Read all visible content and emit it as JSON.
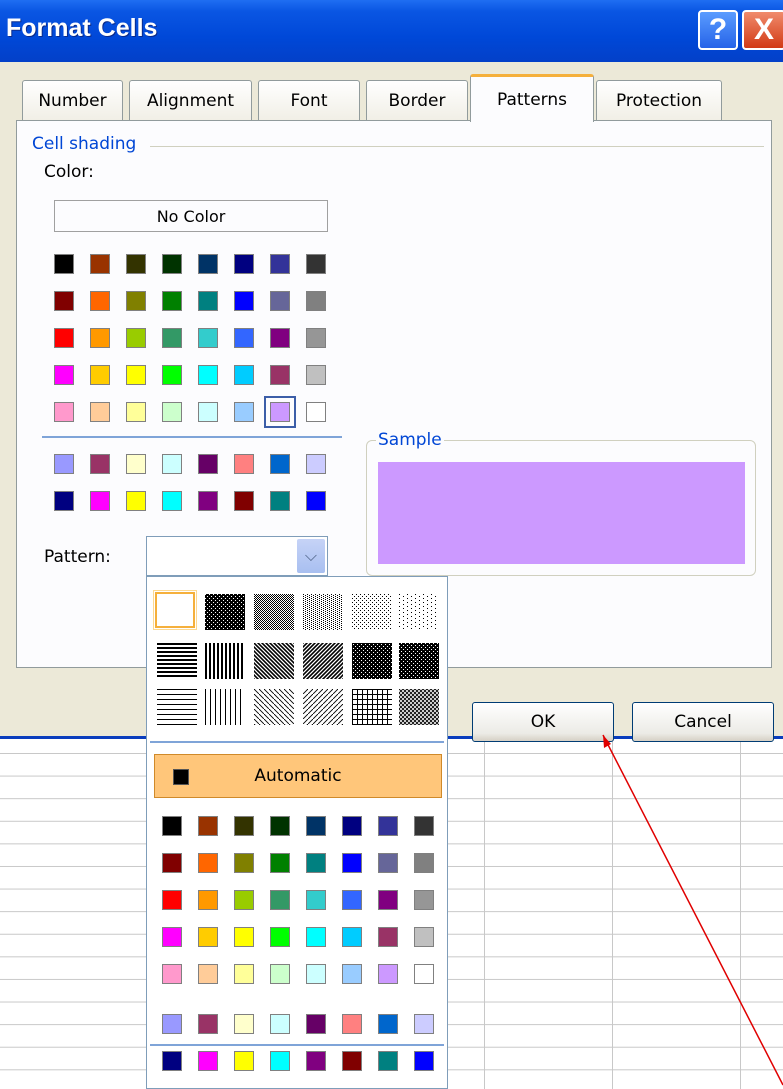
{
  "window": {
    "title": "Format Cells",
    "help_label": "?",
    "close_label": "X"
  },
  "tabs": [
    {
      "label": "Number"
    },
    {
      "label": "Alignment"
    },
    {
      "label": "Font"
    },
    {
      "label": "Border"
    },
    {
      "label": "Patterns",
      "active": true
    },
    {
      "label": "Protection"
    }
  ],
  "cell_shading": {
    "group_label": "Cell shading",
    "color_label": "Color:",
    "no_color_label": "No Color",
    "selected_color": "#cc99ff",
    "palette_main": [
      [
        "#000000",
        "#993300",
        "#333300",
        "#003300",
        "#003366",
        "#000080",
        "#333399",
        "#333333"
      ],
      [
        "#800000",
        "#ff6600",
        "#808000",
        "#008000",
        "#008080",
        "#0000ff",
        "#666699",
        "#808080"
      ],
      [
        "#ff0000",
        "#ff9900",
        "#99cc00",
        "#339966",
        "#33cccc",
        "#3366ff",
        "#800080",
        "#969696"
      ],
      [
        "#ff00ff",
        "#ffcc00",
        "#ffff00",
        "#00ff00",
        "#00ffff",
        "#00ccff",
        "#993366",
        "#c0c0c0"
      ],
      [
        "#ff99cc",
        "#ffcc99",
        "#ffff99",
        "#ccffcc",
        "#ccffff",
        "#99ccff",
        "#cc99ff",
        "#ffffff"
      ]
    ],
    "palette_extra": [
      [
        "#9999ff",
        "#993366",
        "#ffffcc",
        "#ccffff",
        "#660066",
        "#ff8080",
        "#0066cc",
        "#ccccff"
      ],
      [
        "#000080",
        "#ff00ff",
        "#ffff00",
        "#00ffff",
        "#800080",
        "#800000",
        "#008080",
        "#0000ff"
      ]
    ]
  },
  "sample": {
    "label": "Sample",
    "color": "#cc99ff"
  },
  "pattern": {
    "label": "Pattern:",
    "value": ""
  },
  "buttons": {
    "ok_label": "OK",
    "cancel_label": "Cancel"
  },
  "pattern_dropdown": {
    "pattern_names": [
      [
        "solid",
        "75% gray",
        "50% gray",
        "25% gray",
        "12.5% gray",
        "6.25% gray"
      ],
      [
        "thick horizontal stripe",
        "thick vertical stripe",
        "thick reverse diagonal stripe",
        "thick diagonal stripe",
        "thick diagonal crosshatch",
        "thick crosshatch"
      ],
      [
        "thin horizontal stripe",
        "thin vertical stripe",
        "thin reverse diagonal stripe",
        "thin diagonal stripe",
        "thin horizontal crosshatch",
        "thin diagonal crosshatch"
      ]
    ],
    "automatic_label": "Automatic",
    "palette_main": [
      [
        "#000000",
        "#993300",
        "#333300",
        "#003300",
        "#003366",
        "#000080",
        "#333399",
        "#333333"
      ],
      [
        "#800000",
        "#ff6600",
        "#808000",
        "#008000",
        "#008080",
        "#0000ff",
        "#666699",
        "#808080"
      ],
      [
        "#ff0000",
        "#ff9900",
        "#99cc00",
        "#339966",
        "#33cccc",
        "#3366ff",
        "#800080",
        "#969696"
      ],
      [
        "#ff00ff",
        "#ffcc00",
        "#ffff00",
        "#00ff00",
        "#00ffff",
        "#00ccff",
        "#993366",
        "#c0c0c0"
      ],
      [
        "#ff99cc",
        "#ffcc99",
        "#ffff99",
        "#ccffcc",
        "#ccffff",
        "#99ccff",
        "#cc99ff",
        "#ffffff"
      ]
    ],
    "palette_extra": [
      [
        "#9999ff",
        "#993366",
        "#ffffcc",
        "#ccffff",
        "#660066",
        "#ff8080",
        "#0066cc",
        "#ccccff"
      ],
      [
        "#000080",
        "#ff00ff",
        "#ffff00",
        "#00ffff",
        "#800080",
        "#800000",
        "#008080",
        "#0000ff"
      ]
    ]
  },
  "colors": {
    "titlebar": "#0048d8",
    "dialog_bg": "#ece9d8",
    "active_tab_accent": "#f5b03c",
    "group_label": "#0046d5",
    "automatic_highlight": "#ffc67a",
    "annotation_arrow": "#e00000"
  }
}
